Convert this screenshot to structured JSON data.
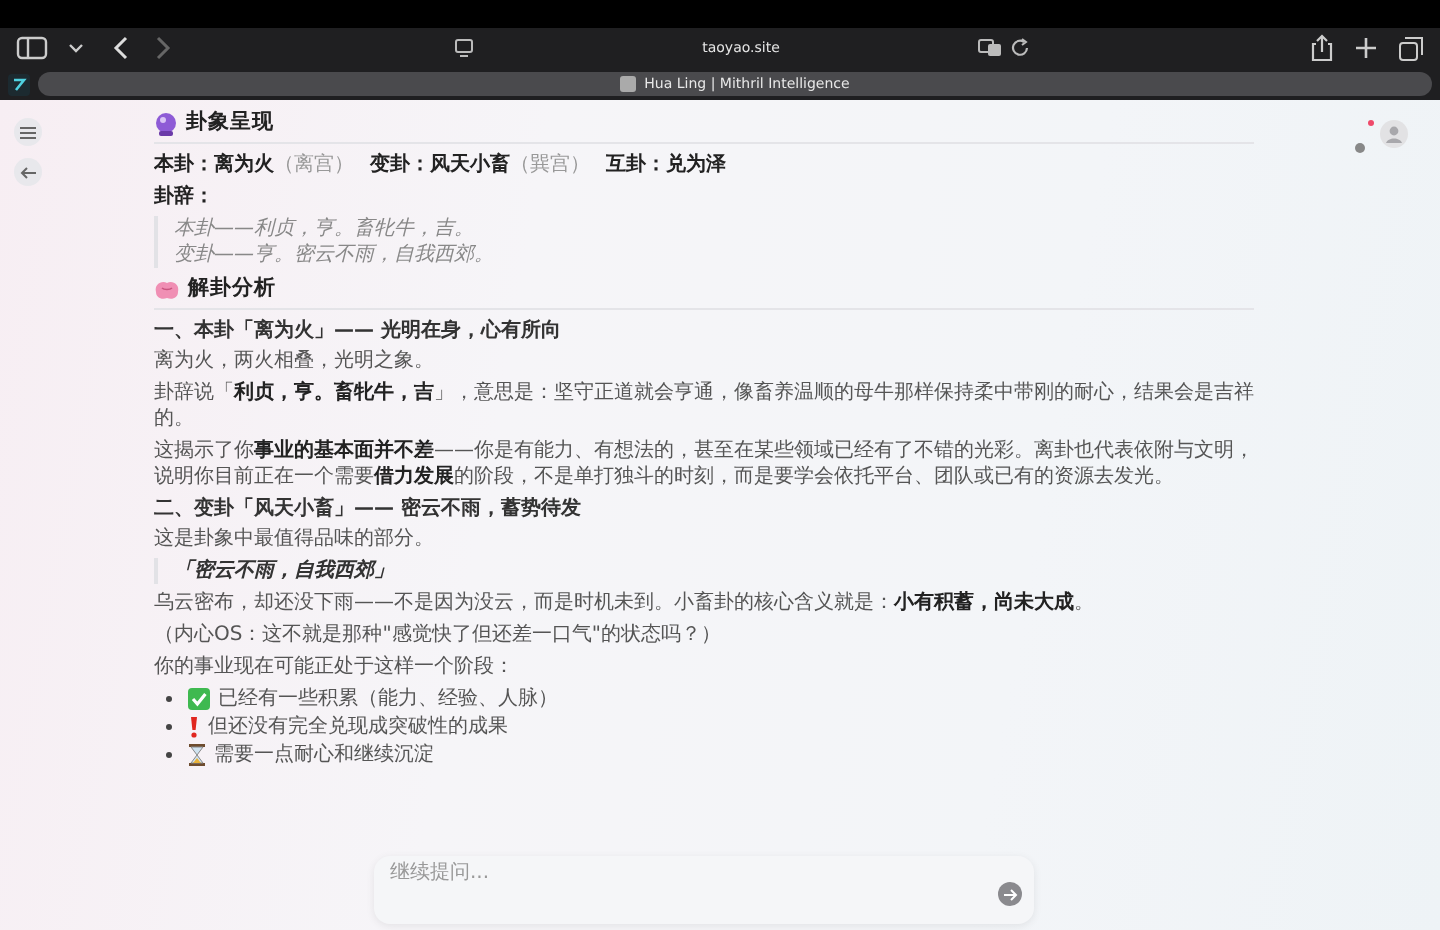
{
  "browser": {
    "url": "taoyao.site",
    "tab_title": "Hua Ling | Mithril Intelligence"
  },
  "sections": [
    {
      "title": "卦象呈现",
      "blocks": [
        {
          "kind": "summary",
          "items": [
            {
              "label": "本卦：",
              "value": "离为火",
              "note": "（离宫）"
            },
            {
              "label": "变卦：",
              "value": "风天小畜",
              "note": "（巽宫）"
            },
            {
              "label": "互卦：",
              "value": "兑为泽"
            }
          ]
        },
        {
          "kind": "label",
          "text": "卦辞："
        },
        {
          "kind": "quote",
          "lines": [
            "本卦——利贞，亨。畜牝牛，吉。",
            "变卦——亨。密云不雨，自我西郊。"
          ]
        }
      ]
    },
    {
      "title": "解卦分析",
      "blocks": [
        {
          "kind": "h3",
          "text": "一、本卦「离为火」—— 光明在身，心有所向"
        },
        {
          "kind": "p",
          "text": "离为火，两火相叠，光明之象。"
        },
        {
          "kind": "p",
          "text": "卦辞说「**利贞，亨。畜牝牛，吉**」，意思是：坚守正道就会亨通，像畜养温顺的母牛那样保持柔中带刚的耐心，结果会是吉祥的。"
        },
        {
          "kind": "p",
          "text": "这揭示了你**事业的基本面并不差**——你是有能力、有想法的，甚至在某些领域已经有了不错的光彩。离卦也代表依附与文明，说明你目前正在一个需要**借力发展**的阶段，不是单打独斗的时刻，而是要学会依托平台、团队或已有的资源去发光。"
        },
        {
          "kind": "h3",
          "text": "二、变卦「风天小畜」—— 密云不雨，蓄势待发"
        },
        {
          "kind": "p",
          "text": "这是卦象中最值得品味的部分。"
        },
        {
          "kind": "callout",
          "text": "「密云不雨，自我西郊」"
        },
        {
          "kind": "p",
          "text": "乌云密布，却还没下雨——不是因为没云，而是时机未到。小畜卦的核心含义就是：**小有积蓄，尚未大成**。"
        },
        {
          "kind": "p",
          "text": "（内心OS：这不就是那种\"感觉快了但还差一口气\"的状态吗？）"
        },
        {
          "kind": "p",
          "text": "你的事业现在可能正处于这样一个阶段："
        },
        {
          "kind": "list",
          "items": [
            {
              "text": "已经有一些积累（能力、经验、人脉）"
            },
            {
              "text": "但还没有完全兑现成突破性的成果"
            },
            {
              "text": "需要一点耐心和继续沉淀"
            }
          ]
        }
      ]
    }
  ],
  "composer": {
    "placeholder": "继续提问..."
  }
}
